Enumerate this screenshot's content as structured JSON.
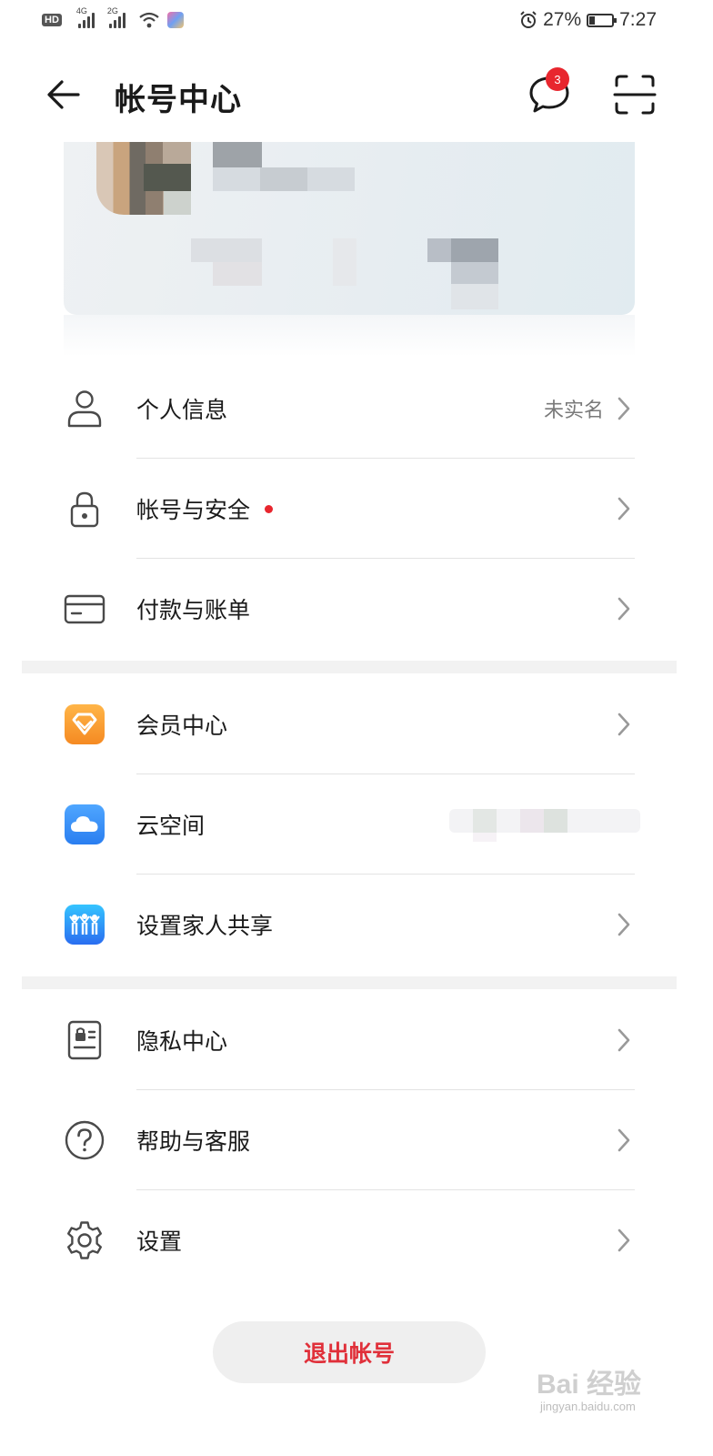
{
  "status_bar": {
    "network_badge": "HD",
    "signal1_tag": "4G",
    "signal2_tag": "2G",
    "battery_percent": "27%",
    "battery_level": 0.27,
    "time": "7:27"
  },
  "header": {
    "title": "帐号中心",
    "message_count": "3"
  },
  "sections": [
    [
      {
        "label": "个人信息",
        "value": "未实名",
        "icon": "person-icon"
      },
      {
        "label": "帐号与安全",
        "value": "",
        "icon": "lock-icon",
        "red_dot": true
      },
      {
        "label": "付款与账单",
        "value": "",
        "icon": "card-icon"
      }
    ],
    [
      {
        "label": "会员中心",
        "value": "",
        "icon": "diamond-icon"
      },
      {
        "label": "云空间",
        "value": "",
        "icon": "cloud-icon"
      },
      {
        "label": "设置家人共享",
        "value": "",
        "icon": "family-icon"
      }
    ],
    [
      {
        "label": "隐私中心",
        "value": "",
        "icon": "privacy-icon"
      },
      {
        "label": "帮助与客服",
        "value": "",
        "icon": "help-icon"
      },
      {
        "label": "设置",
        "value": "",
        "icon": "gear-icon"
      }
    ]
  ],
  "logout_label": "退出帐号",
  "watermark": {
    "brand": "Bai 经验",
    "url": "jingyan.baidu.com"
  },
  "colors": {
    "accent_red": "#e8262e",
    "divider": "#e3e3e3",
    "group_separator": "#f2f2f2"
  }
}
